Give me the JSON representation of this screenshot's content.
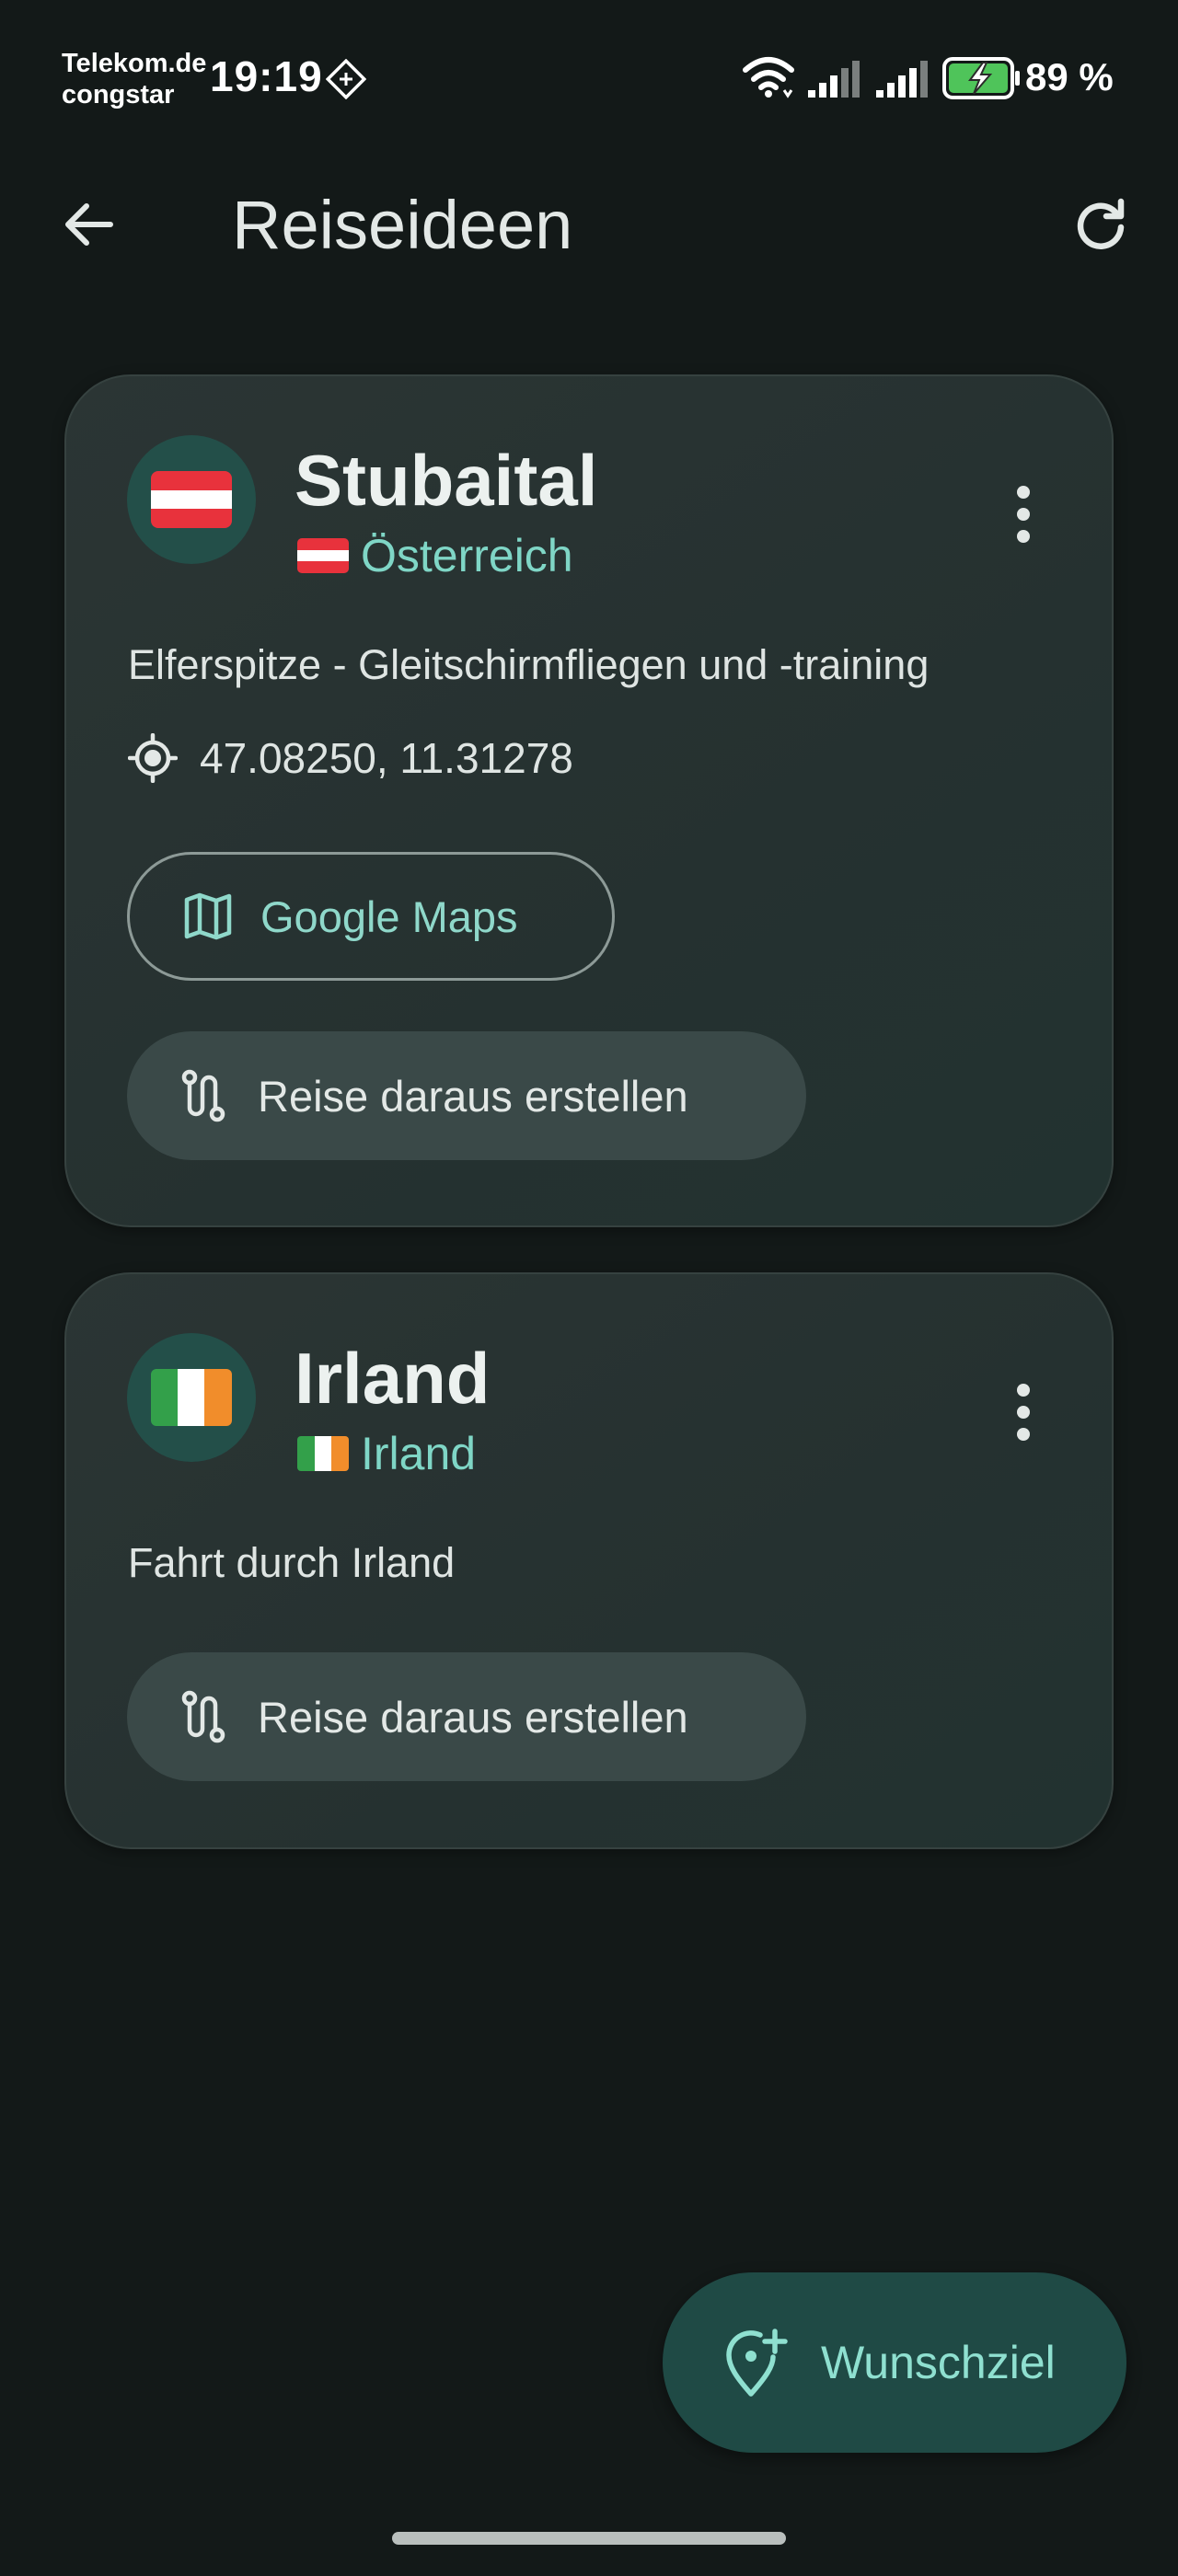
{
  "status_bar": {
    "carrier_line1": "Telekom.de",
    "carrier_line2": "congstar",
    "time": "19:19",
    "battery": "89 %",
    "icons": [
      "nfc-icon",
      "wifi-icon",
      "signal-icon",
      "signal-icon",
      "battery-charging-icon"
    ]
  },
  "app_bar": {
    "title": "Reiseideen",
    "back_icon": "arrow-left-icon",
    "refresh_icon": "refresh-icon"
  },
  "ideas": [
    {
      "title": "Stubaital",
      "flag": "austria-flag",
      "country": "Österreich",
      "description": "Elferspitze - Gleitschirmfliegen und -training",
      "coordinates": "47.08250, 11.31278",
      "maps_label": "Google Maps",
      "create_trip_label": "Reise daraus erstellen"
    },
    {
      "title": "Irland",
      "flag": "ireland-flag",
      "country": "Irland",
      "description": "Fahrt durch Irland",
      "create_trip_label": "Reise daraus erstellen"
    }
  ],
  "fab": {
    "label": "Wunschziel",
    "icon": "add-location-icon"
  },
  "colors": {
    "background": "#131918",
    "card": "#2a3433",
    "accent": "#7fd6c6",
    "fab": "#1f4a45",
    "tonal_button": "#3a4948"
  }
}
